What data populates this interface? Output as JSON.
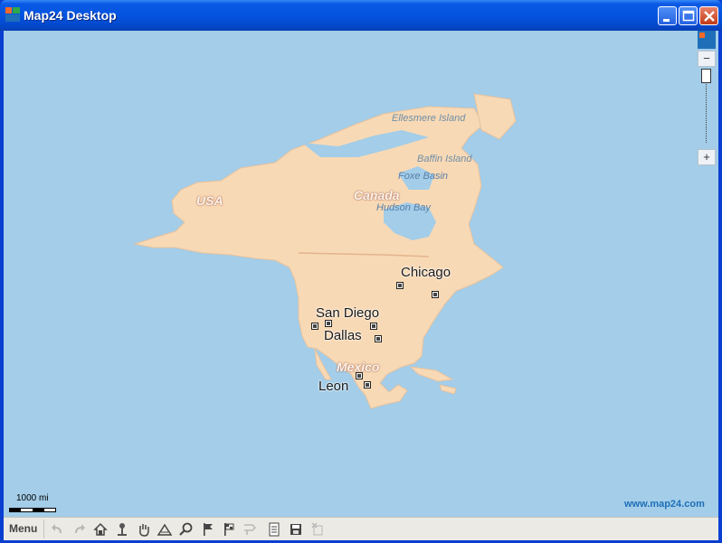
{
  "window": {
    "title": "Map24 Desktop"
  },
  "map": {
    "cities": [
      {
        "name": "Chicago"
      },
      {
        "name": "San Diego"
      },
      {
        "name": "Dallas"
      },
      {
        "name": "Leon"
      }
    ],
    "countries": [
      {
        "name": "USA"
      },
      {
        "name": "Canada"
      },
      {
        "name": "Mexico"
      }
    ],
    "water_features": [
      {
        "name": "Foxe Basin"
      },
      {
        "name": "Hudson Bay"
      }
    ],
    "islands": [
      {
        "name": "Ellesmere Island"
      },
      {
        "name": "Baffin Island"
      }
    ],
    "scale_label": "1000 mi",
    "site_link": "www.map24.com",
    "colors": {
      "water": "#a3cde8",
      "land": "#f8d9b5",
      "accent": "#1f6fb8"
    }
  },
  "toolbar": {
    "menu_label": "Menu",
    "tools": [
      "undo-icon",
      "redo-icon",
      "home-icon",
      "pin-icon",
      "hand-icon",
      "measure-icon",
      "magnifier-icon",
      "flag-start-icon",
      "flag-end-icon",
      "route-icon",
      "document-icon",
      "save-icon",
      "delete-icon"
    ]
  }
}
